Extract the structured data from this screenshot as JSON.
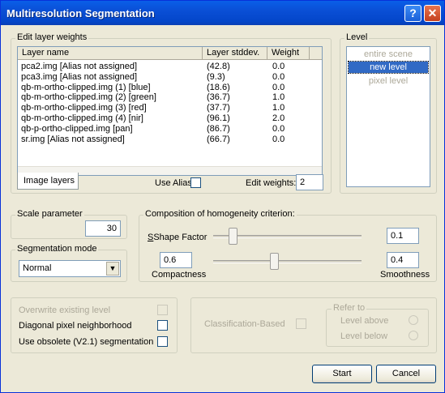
{
  "window": {
    "title": "Multiresolution Segmentation",
    "help_glyph": "?",
    "close_glyph": "✕"
  },
  "edit_layer_weights": {
    "label": "Edit layer weights",
    "columns": [
      "Layer name",
      "Layer stddev.",
      "Weight"
    ],
    "rows": [
      {
        "name": "pca2.img [Alias not assigned]",
        "stddev": "(42.8)",
        "weight": "0.0"
      },
      {
        "name": "pca3.img [Alias not assigned]",
        "stddev": "(9.3)",
        "weight": "0.0"
      },
      {
        "name": "qb-m-ortho-clipped.img (1) [blue]",
        "stddev": "(18.6)",
        "weight": "0.0"
      },
      {
        "name": "qb-m-ortho-clipped.img (2) [green]",
        "stddev": "(36.7)",
        "weight": "1.0"
      },
      {
        "name": "qb-m-ortho-clipped.img (3) [red]",
        "stddev": "(37.7)",
        "weight": "1.0"
      },
      {
        "name": "qb-m-ortho-clipped.img (4) [nir]",
        "stddev": "(96.1)",
        "weight": "2.0"
      },
      {
        "name": "qb-p-ortho-clipped.img [pan]",
        "stddev": "(86.7)",
        "weight": "0.0"
      },
      {
        "name": "sr.img [Alias not assigned]",
        "stddev": "(66.7)",
        "weight": "0.0"
      }
    ],
    "tab_label": "Image layers",
    "use_alias_label": "Use Alias",
    "edit_weights_label": "Edit weights:",
    "edit_weights_value": "2"
  },
  "level": {
    "label": "Level",
    "items": [
      "entire scene",
      "new level",
      "pixel level"
    ],
    "selected": "new level"
  },
  "scale": {
    "label": "Scale parameter",
    "value": "30"
  },
  "segmentation_mode": {
    "label": "Segmentation mode",
    "value": "Normal"
  },
  "homogeneity": {
    "label": "Composition of homogeneity criterion:",
    "shape_label": "Shape Factor",
    "shape_value": "0.1",
    "compactness_value": "0.6",
    "compactness_label": "Compactness",
    "smoothness_value": "0.4",
    "smoothness_label": "Smoothness"
  },
  "options": {
    "overwrite": "Overwrite existing level",
    "diagonal": "Diagonal pixel neighborhood",
    "obsolete": "Use obsolete (V2.1) segmentation"
  },
  "classification": {
    "label": "Classification-Based",
    "refer_to": "Refer to",
    "level_above": "Level above",
    "level_below": "Level below"
  },
  "buttons": {
    "start": "Start",
    "cancel": "Cancel"
  },
  "colors": {
    "selected_bg": "#316ac5",
    "title_bar": "#0a4fd6"
  }
}
